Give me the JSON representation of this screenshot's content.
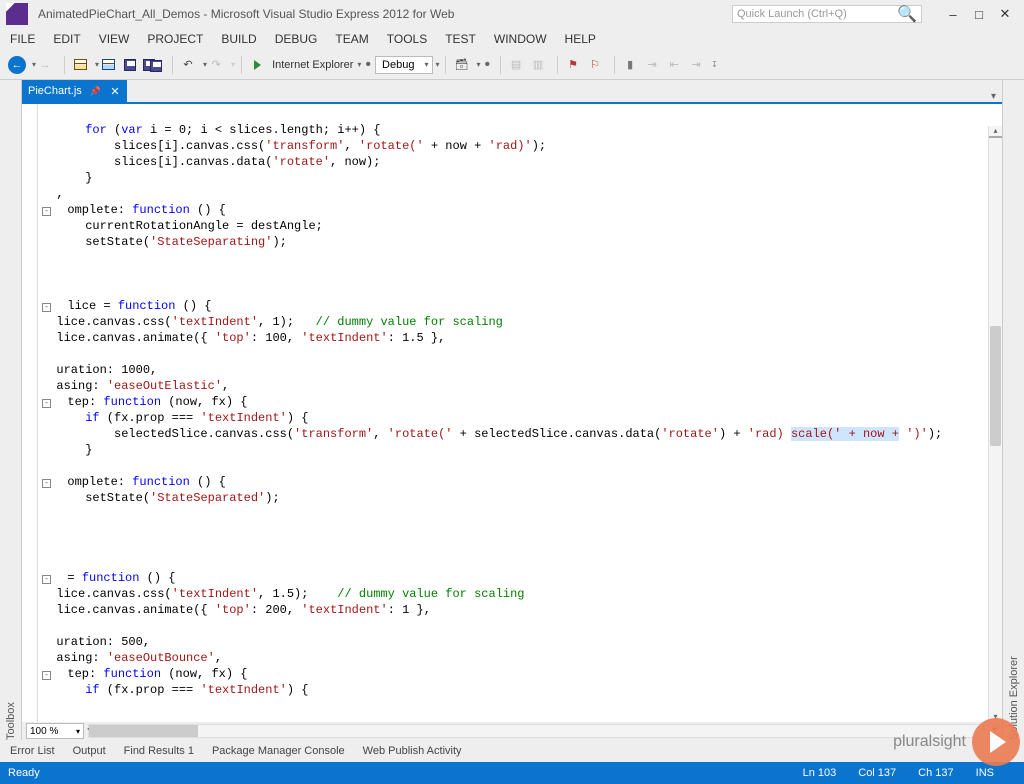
{
  "titlebar": {
    "title": "AnimatedPieChart_All_Demos - Microsoft Visual Studio Express 2012 for Web",
    "quick_launch_placeholder": "Quick Launch (Ctrl+Q)"
  },
  "menubar": [
    "FILE",
    "EDIT",
    "VIEW",
    "PROJECT",
    "BUILD",
    "DEBUG",
    "TEAM",
    "TOOLS",
    "TEST",
    "WINDOW",
    "HELP"
  ],
  "toolbar": {
    "run_target": "Internet Explorer",
    "config": "Debug"
  },
  "rails": {
    "left": "Toolbox",
    "right": "Solution Explorer"
  },
  "tab": {
    "filename": "PieChart.js"
  },
  "zoom": "100 %",
  "tool_windows": [
    "Error List",
    "Output",
    "Find Results 1",
    "Package Manager Console",
    "Web Publish Activity"
  ],
  "statusbar": {
    "state": "Ready",
    "ln": "Ln 103",
    "col": "Col 137",
    "ch": "Ch 137",
    "ins": "INS"
  },
  "brand": "pluralsight",
  "code": {
    "l1a": "      for",
    "l1b": " (",
    "l1c": "var",
    "l1d": " i = 0; i < slices.length; i++) {",
    "l2a": "          slices[i].canvas.css(",
    "l2b": "'transform'",
    "l2c": ", ",
    "l2d": "'rotate('",
    "l2e": " + now + ",
    "l2f": "'rad)'",
    "l2g": ");",
    "l3a": "          slices[i].canvas.data(",
    "l3b": "'rotate'",
    "l3c": ", now);",
    "l4": "      }",
    "l5": "  ,",
    "l6a": "  omplete: ",
    "l6b": "function",
    "l6c": " () {",
    "l7": "      currentRotationAngle = destAngle;",
    "l8a": "      setState(",
    "l8b": "'StateSeparating'",
    "l8c": ");",
    "lcb": "  ",
    "l11a": "  lice = ",
    "l11b": "function",
    "l11c": " () {",
    "l12a": "  lice.canvas.css(",
    "l12b": "'textIndent'",
    "l12c": ", 1);   ",
    "l12d": "// dummy value for scaling",
    "l13a": "  lice.canvas.animate({ ",
    "l13b": "'top'",
    "l13c": ": 100, ",
    "l13d": "'textIndent'",
    "l13e": ": 1.5 },",
    "l15": "  uration: 1000,",
    "l16a": "  asing: ",
    "l16b": "'easeOutElastic'",
    "l16c": ",",
    "l17a": "  tep: ",
    "l17b": "function",
    "l17c": " (now, fx) {",
    "l18a": "      if",
    "l18b": " (fx.prop === ",
    "l18c": "'textIndent'",
    "l18d": ") {",
    "l19a": "          selectedSlice.canvas.css(",
    "l19b": "'transform'",
    "l19c": ", ",
    "l19d": "'rotate('",
    "l19e": " + selectedSlice.canvas.data(",
    "l19f": "'rotate'",
    "l19g": ") + ",
    "l19h": "'rad) ",
    "l19i": "scale(' + now +",
    "l19j": " ')'",
    "l19k": ");",
    "l20": "      }",
    "l22a": "  omplete: ",
    "l22b": "function",
    "l22c": " () {",
    "l23a": "      setState(",
    "l23b": "'StateSeparated'",
    "l23c": ");",
    "l27a": "  = ",
    "l27b": "function",
    "l27c": " () {",
    "l28a": "  lice.canvas.css(",
    "l28b": "'textIndent'",
    "l28c": ", 1.5);    ",
    "l28d": "// dummy value for scaling",
    "l29a": "  lice.canvas.animate({ ",
    "l29b": "'top'",
    "l29c": ": 200, ",
    "l29d": "'textIndent'",
    "l29e": ": 1 },",
    "l31": "  uration: 500,",
    "l32a": "  asing: ",
    "l32b": "'easeOutBounce'",
    "l32c": ",",
    "l33a": "  tep: ",
    "l33b": "function",
    "l33c": " (now, fx) {",
    "l34a": "      if",
    "l34b": " (fx.prop === ",
    "l34c": "'textIndent'",
    "l34d": ") {"
  }
}
